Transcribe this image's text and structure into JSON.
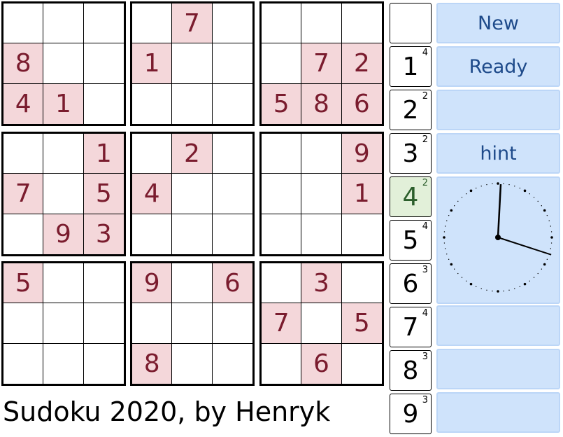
{
  "grid": [
    [
      "",
      "",
      "",
      "",
      "7",
      "",
      "",
      "",
      ""
    ],
    [
      "8",
      "",
      "",
      "1",
      "",
      "",
      "",
      "7",
      "2"
    ],
    [
      "4",
      "1",
      "",
      "",
      "",
      "",
      "5",
      "8",
      "6"
    ],
    [
      "",
      "",
      "1",
      "",
      "2",
      "",
      "",
      "",
      "9"
    ],
    [
      "7",
      "",
      "5",
      "4",
      "",
      "",
      "",
      "",
      "1"
    ],
    [
      "",
      "9",
      "3",
      "",
      "",
      "",
      "",
      "",
      ""
    ],
    [
      "5",
      "",
      "",
      "9",
      "",
      "6",
      "",
      "3",
      ""
    ],
    [
      "",
      "",
      "",
      "",
      "",
      "",
      "7",
      "",
      "5"
    ],
    [
      "",
      "",
      "",
      "8",
      "",
      "",
      "",
      "6",
      ""
    ]
  ],
  "numbers": [
    {
      "n": "",
      "c": ""
    },
    {
      "n": "1",
      "c": "4"
    },
    {
      "n": "2",
      "c": "2"
    },
    {
      "n": "3",
      "c": "2"
    },
    {
      "n": "4",
      "c": "2"
    },
    {
      "n": "5",
      "c": "4"
    },
    {
      "n": "6",
      "c": "3"
    },
    {
      "n": "7",
      "c": "4"
    },
    {
      "n": "8",
      "c": "3"
    },
    {
      "n": "9",
      "c": "3"
    }
  ],
  "selected_number": "4",
  "buttons": {
    "new": "New",
    "ready": "Ready",
    "blank1": "",
    "hint": "hint"
  },
  "clock": {
    "hour": 3.6,
    "minute": 0.5
  },
  "title": "Sudoku 2020, by Henryk"
}
